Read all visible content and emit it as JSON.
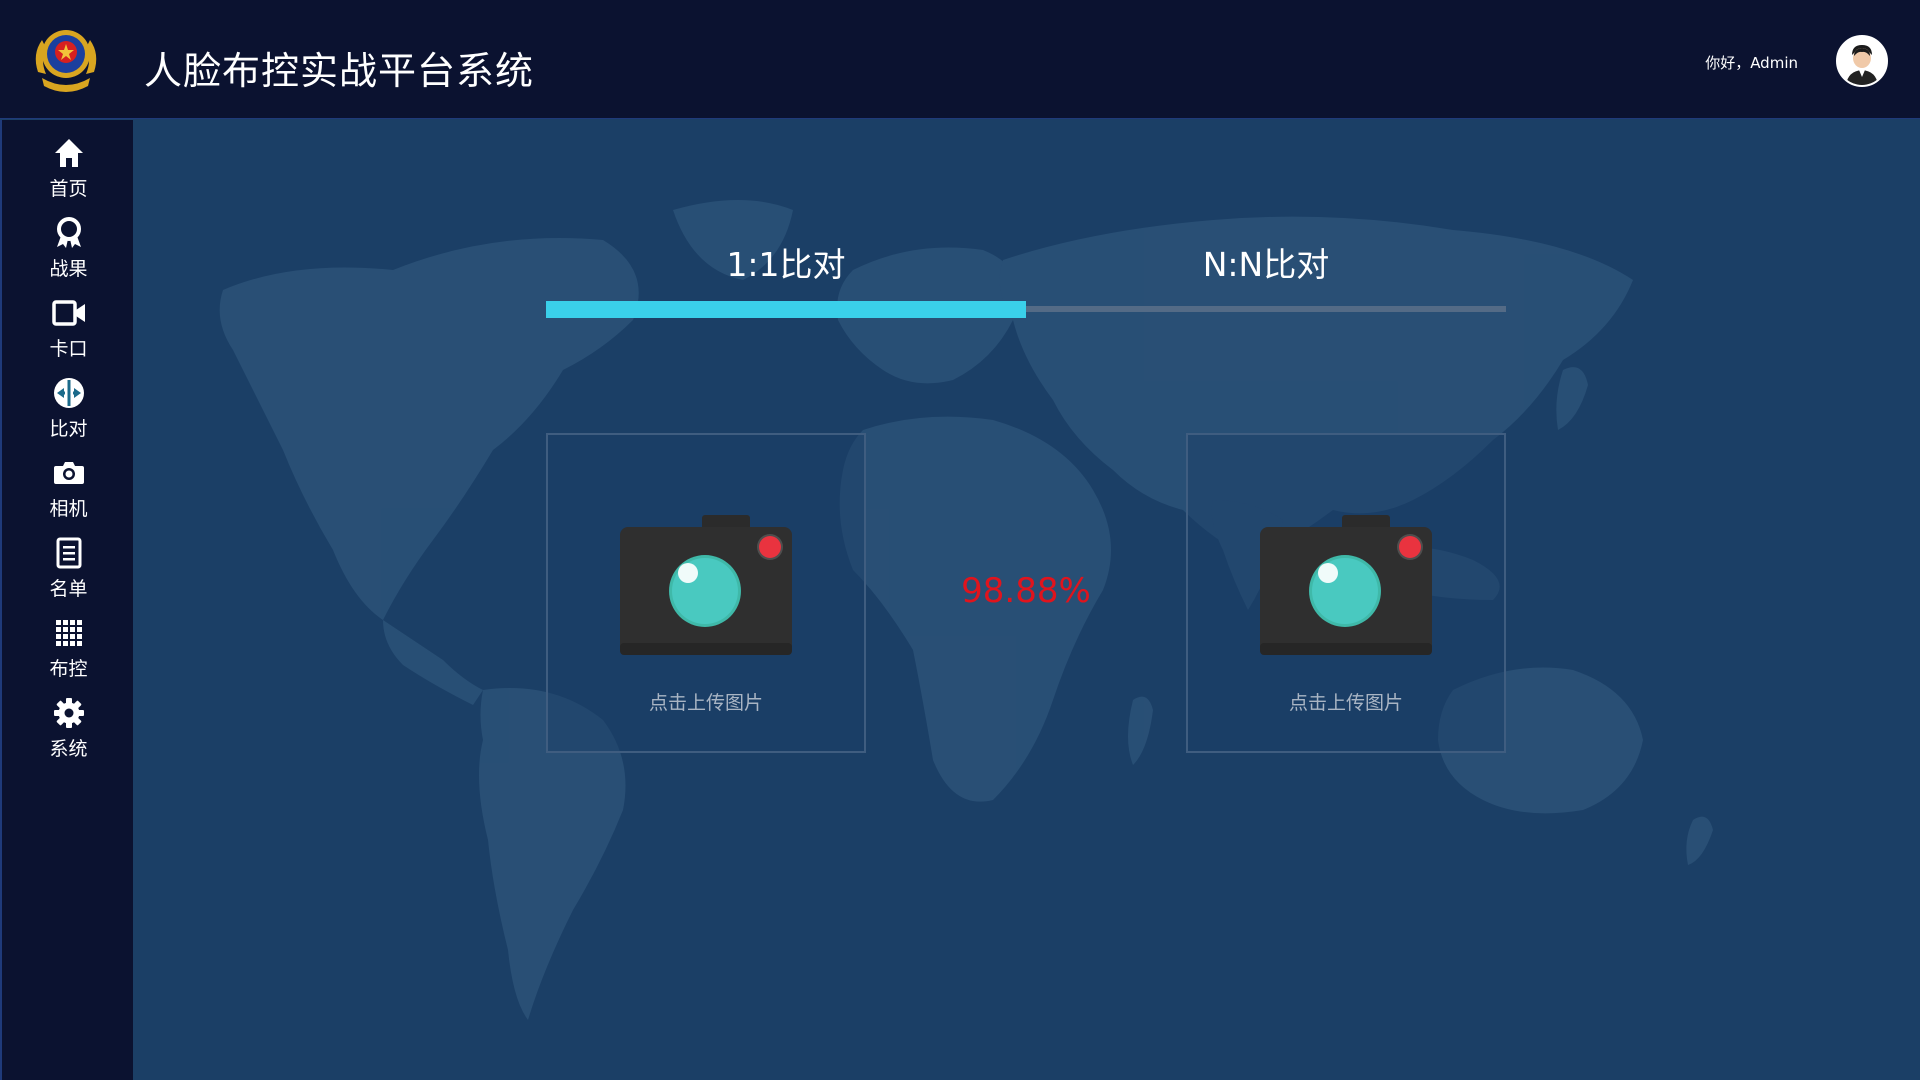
{
  "header": {
    "title": "人脸布控实战平台系统",
    "greeting": "你好，Admin",
    "logo_icon": "police-emblem-icon",
    "avatar_icon": "user-avatar-icon"
  },
  "sidebar": {
    "items": [
      {
        "label": "首页",
        "icon": "home-icon"
      },
      {
        "label": "战果",
        "icon": "award-icon"
      },
      {
        "label": "卡口",
        "icon": "video-camera-icon"
      },
      {
        "label": "比对",
        "icon": "compare-icon",
        "active": true
      },
      {
        "label": "相机",
        "icon": "camera-icon"
      },
      {
        "label": "名单",
        "icon": "document-list-icon"
      },
      {
        "label": "布控",
        "icon": "grid-icon"
      },
      {
        "label": "系统",
        "icon": "gear-icon"
      }
    ]
  },
  "main": {
    "tabs": [
      {
        "label": "1:1比对",
        "active": true
      },
      {
        "label": "N:N比对",
        "active": false
      }
    ],
    "upload_left": {
      "label": "点击上传图片"
    },
    "upload_right": {
      "label": "点击上传图片"
    },
    "similarity": "98.88%"
  },
  "colors": {
    "header_bg": "#0b1230",
    "main_bg": "#1b3f66",
    "map_land": "#2b5278",
    "tab_active": "#3ad0ea",
    "score": "#e0141d"
  }
}
